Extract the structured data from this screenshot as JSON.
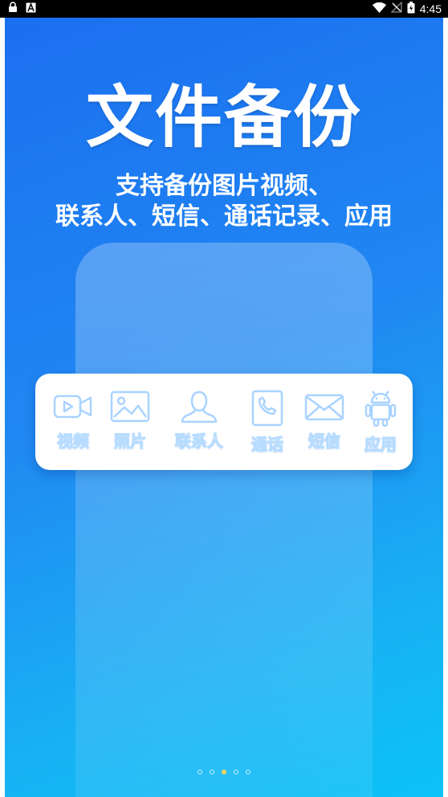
{
  "status_bar": {
    "time": "4:45",
    "icons": [
      "lock-icon",
      "a-icon",
      "wifi-icon",
      "no-signal-icon",
      "battery-icon"
    ]
  },
  "hero": {
    "title": "文件备份",
    "subtitle_line1": "支持备份图片视频、",
    "subtitle_line2": "联系人、短信、通话记录、应用"
  },
  "categories": [
    {
      "label": "视频",
      "icon": "video-icon"
    },
    {
      "label": "照片",
      "icon": "photo-icon"
    },
    {
      "label": "联系人",
      "icon": "contact-icon"
    },
    {
      "label": "通话",
      "icon": "phone-call-icon"
    },
    {
      "label": "短信",
      "icon": "message-icon"
    },
    {
      "label": "应用",
      "icon": "android-icon"
    }
  ],
  "pager": {
    "count": 5,
    "active_index": 2
  },
  "colors": {
    "gradient_top": "#1b6ff0",
    "gradient_bottom": "#0bc3f6",
    "icon_outline": "#a9d3ff",
    "active_dot": "#ffd35c"
  }
}
